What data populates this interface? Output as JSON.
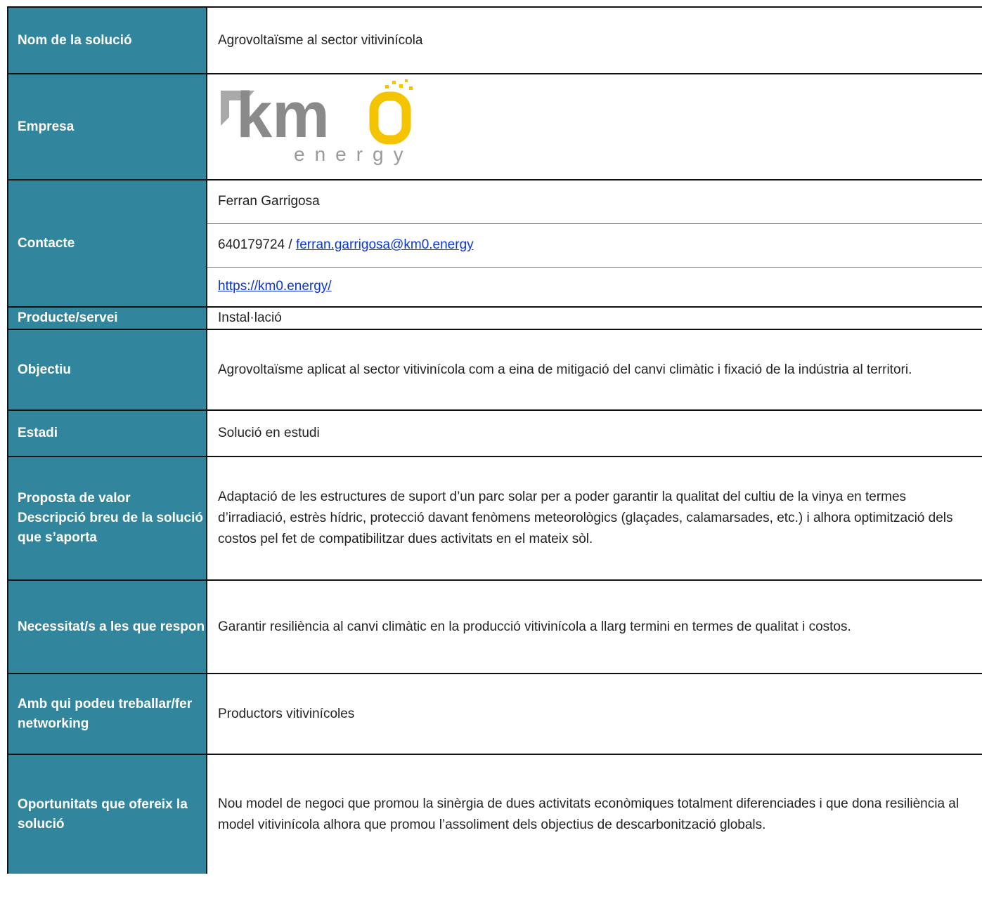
{
  "rows": {
    "nom": {
      "label": "Nom de la solució",
      "value": "Agrovoltaïsme al sector vitivinícola"
    },
    "empresa": {
      "label": "Empresa",
      "logo_text": "km0",
      "logo_sub": "energy"
    },
    "contacte": {
      "label": "Contacte",
      "name": "Ferran Garrigosa",
      "phone": "640179724",
      "separator": " / ",
      "email": "ferran.garrigosa@km0.energy",
      "website": "https://km0.energy/"
    },
    "producte": {
      "label": "Producte/servei",
      "value": "Instal·lació"
    },
    "objectiu": {
      "label": "Objectiu",
      "value": "Agrovoltaïsme aplicat al sector vitivinícola com a eina de mitigació del canvi climàtic i fixació de la indústria al territori."
    },
    "estadi": {
      "label": "Estadi",
      "value": "Solució en estudi"
    },
    "proposta": {
      "label_line1": "Proposta de valor",
      "label_line2": "Descripció breu de la solució que s’aporta",
      "value": "Adaptació de les estructures de suport d’un parc solar per a poder garantir la qualitat del cultiu de la vinya en termes d’irradiació, estrès hídric, protecció davant fenòmens meteorològics (glaçades, calamarsades, etc.) i alhora optimització dels costos pel fet de compatibilitzar dues activitats en el mateix sòl."
    },
    "necessitats": {
      "label": "Necessitat/s a les que respon",
      "value": "Garantir resiliència al canvi climàtic en la producció vitivinícola a llarg termini en termes de qualitat i costos."
    },
    "amb_qui": {
      "label": "Amb qui podeu treballar/fer networking",
      "value": "Productors vitivinícoles"
    },
    "oportunitats": {
      "label": "Oportunitats que ofereix la solució",
      "value": "Nou model de negoci que promou la sinèrgia de dues activitats econòmiques totalment diferenciades i que dona resiliència al model vitivinícola alhora que promou l’assoliment dels objectius de descarbonització globals."
    }
  },
  "colors": {
    "label_bg": "#31859c",
    "label_text": "#ffffff",
    "link": "#0b37d6",
    "logo_grey": "#8a8a8a",
    "logo_yellow": "#f5c400"
  }
}
